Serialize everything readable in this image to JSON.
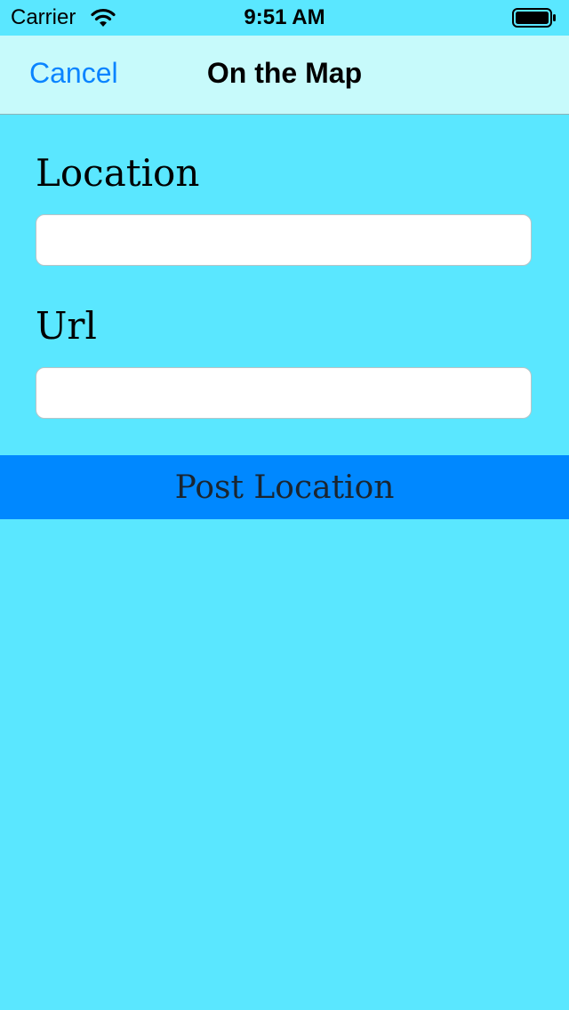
{
  "status_bar": {
    "carrier": "Carrier",
    "time": "9:51 AM",
    "wifi_icon": "wifi-icon",
    "battery_icon": "battery-icon"
  },
  "nav": {
    "cancel_label": "Cancel",
    "title": "On the Map"
  },
  "form": {
    "location_label": "Location",
    "location_value": "",
    "location_placeholder": "",
    "url_label": "Url",
    "url_value": "",
    "url_placeholder": "",
    "post_button_label": "Post Location"
  },
  "colors": {
    "background": "#5AE7FF",
    "nav_background": "#C7FAFB",
    "accent": "#0A84FF",
    "button_background": "#0088FF"
  }
}
